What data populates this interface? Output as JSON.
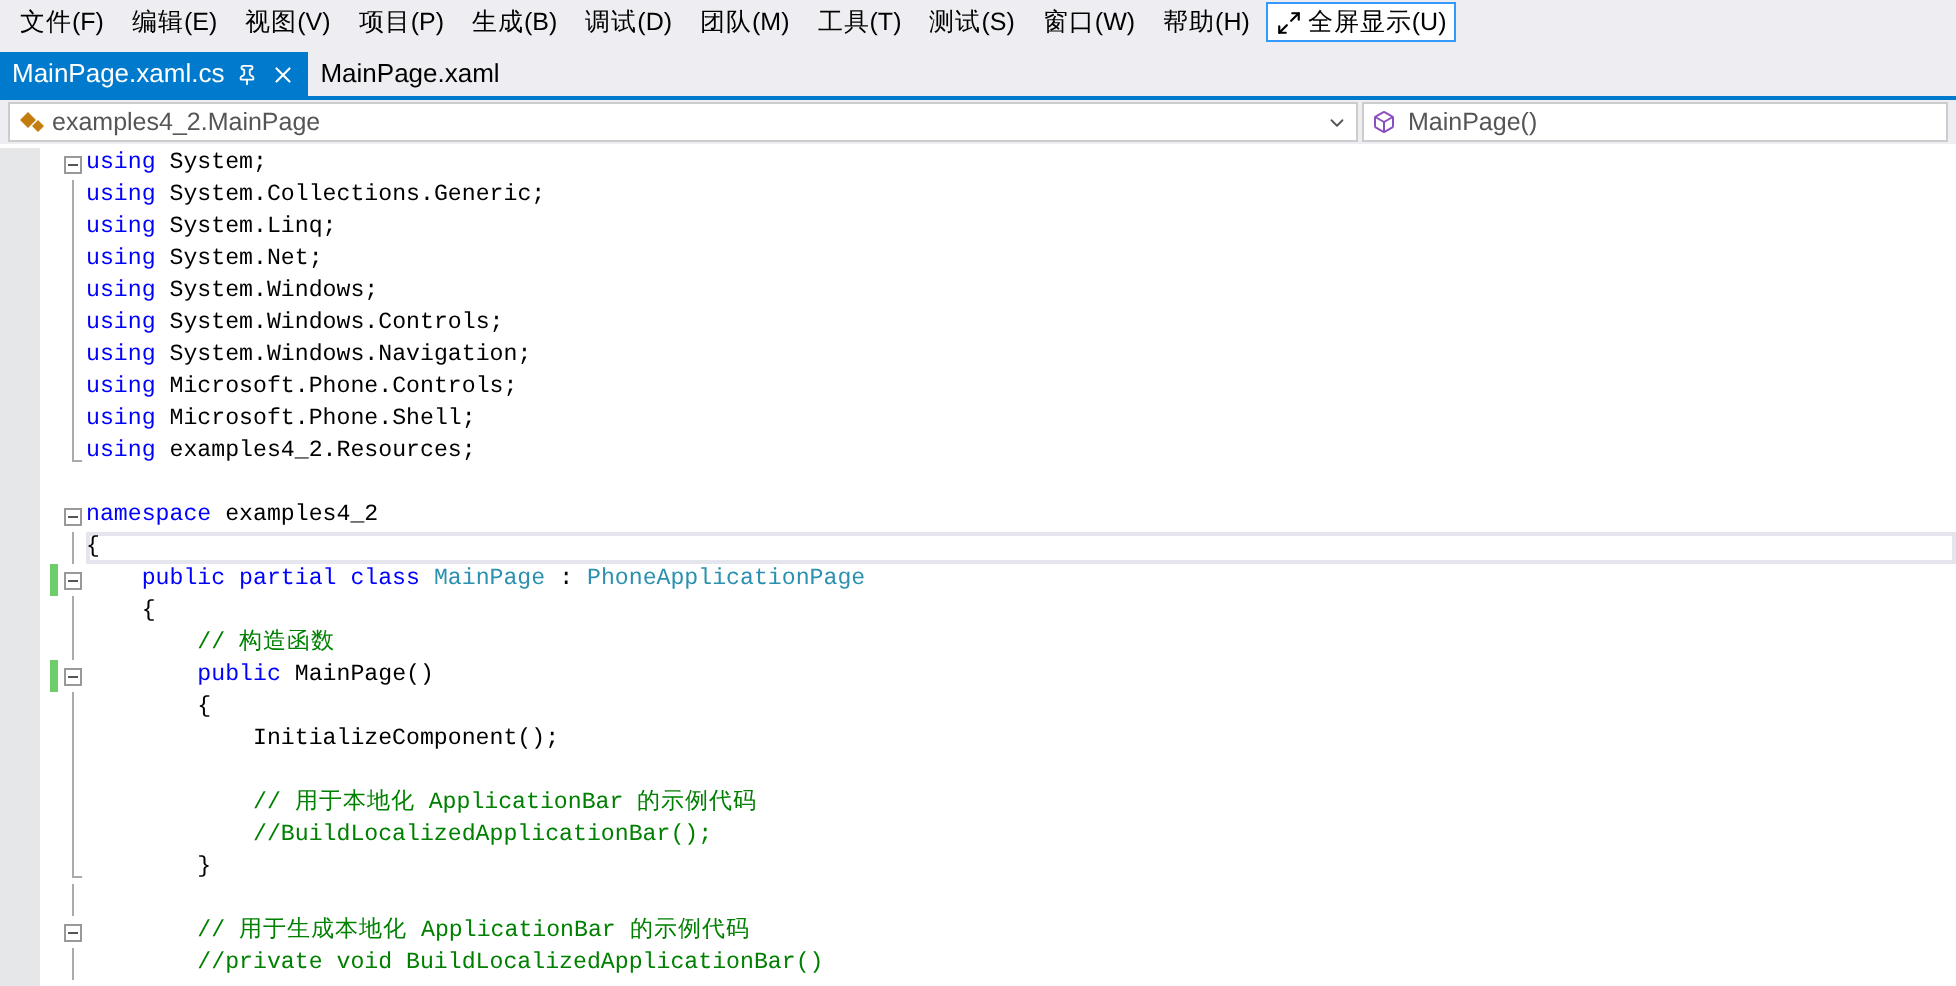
{
  "menu": [
    {
      "label": "文件(F)"
    },
    {
      "label": "编辑(E)"
    },
    {
      "label": "视图(V)"
    },
    {
      "label": "项目(P)"
    },
    {
      "label": "生成(B)"
    },
    {
      "label": "调试(D)"
    },
    {
      "label": "团队(M)"
    },
    {
      "label": "工具(T)"
    },
    {
      "label": "测试(S)"
    },
    {
      "label": "窗口(W)"
    },
    {
      "label": "帮助(H)"
    }
  ],
  "fullscreen_button": {
    "label": "全屏显示(U)"
  },
  "tabs": [
    {
      "label": "MainPage.xaml.cs",
      "selected": true
    },
    {
      "label": "MainPage.xaml",
      "selected": false
    }
  ],
  "nav": {
    "type_dropdown": "examples4_2.MainPage",
    "member_dropdown": "MainPage()"
  },
  "code": [
    {
      "kind": "start",
      "changed": false,
      "current": false,
      "tokens": [
        {
          "kind": "keyword",
          "t": "using"
        },
        {
          "kind": "plain",
          "t": " System;"
        }
      ]
    },
    {
      "kind": "body",
      "changed": false,
      "current": false,
      "tokens": [
        {
          "kind": "keyword",
          "t": "using"
        },
        {
          "kind": "plain",
          "t": " System.Collections.Generic;"
        }
      ]
    },
    {
      "kind": "body",
      "changed": false,
      "current": false,
      "tokens": [
        {
          "kind": "keyword",
          "t": "using"
        },
        {
          "kind": "plain",
          "t": " System.Linq;"
        }
      ]
    },
    {
      "kind": "body",
      "changed": false,
      "current": false,
      "tokens": [
        {
          "kind": "keyword",
          "t": "using"
        },
        {
          "kind": "plain",
          "t": " System.Net;"
        }
      ]
    },
    {
      "kind": "body",
      "changed": false,
      "current": false,
      "tokens": [
        {
          "kind": "keyword",
          "t": "using"
        },
        {
          "kind": "plain",
          "t": " System.Windows;"
        }
      ]
    },
    {
      "kind": "body",
      "changed": false,
      "current": false,
      "tokens": [
        {
          "kind": "keyword",
          "t": "using"
        },
        {
          "kind": "plain",
          "t": " System.Windows.Controls;"
        }
      ]
    },
    {
      "kind": "body",
      "changed": false,
      "current": false,
      "tokens": [
        {
          "kind": "keyword",
          "t": "using"
        },
        {
          "kind": "plain",
          "t": " System.Windows.Navigation;"
        }
      ]
    },
    {
      "kind": "body",
      "changed": false,
      "current": false,
      "tokens": [
        {
          "kind": "keyword",
          "t": "using"
        },
        {
          "kind": "plain",
          "t": " Microsoft.Phone.Controls;"
        }
      ]
    },
    {
      "kind": "body",
      "changed": false,
      "current": false,
      "tokens": [
        {
          "kind": "keyword",
          "t": "using"
        },
        {
          "kind": "plain",
          "t": " Microsoft.Phone.Shell;"
        }
      ]
    },
    {
      "kind": "end",
      "changed": false,
      "current": false,
      "tokens": [
        {
          "kind": "keyword",
          "t": "using"
        },
        {
          "kind": "plain",
          "t": " examples4_2.Resources;"
        }
      ]
    },
    {
      "kind": "blank",
      "changed": false,
      "current": false
    },
    {
      "kind": "start",
      "changed": false,
      "current": false,
      "tokens": [
        {
          "kind": "keyword",
          "t": "namespace"
        },
        {
          "kind": "plain",
          "t": " examples4_2"
        }
      ]
    },
    {
      "kind": "body",
      "changed": false,
      "current": true,
      "tokens": [
        {
          "kind": "plain",
          "t": "{"
        }
      ]
    },
    {
      "kind": "start",
      "changed": true,
      "current": false,
      "tokens": [
        {
          "kind": "keyword",
          "t": "    public partial class"
        },
        {
          "kind": "type",
          "t": " MainPage"
        },
        {
          "kind": "plain",
          "t": " : "
        },
        {
          "kind": "type",
          "t": "PhoneApplicationPage"
        }
      ]
    },
    {
      "kind": "body",
      "changed": false,
      "current": false,
      "tokens": [
        {
          "kind": "plain",
          "t": "    {"
        }
      ]
    },
    {
      "kind": "body",
      "changed": false,
      "current": false,
      "tokens": [
        {
          "kind": "comment",
          "t": "        // 构造函数"
        }
      ]
    },
    {
      "kind": "start",
      "changed": true,
      "current": false,
      "tokens": [
        {
          "kind": "keyword",
          "t": "        public"
        },
        {
          "kind": "plain",
          "t": " MainPage()"
        }
      ]
    },
    {
      "kind": "body",
      "changed": false,
      "current": false,
      "tokens": [
        {
          "kind": "plain",
          "t": "        {"
        }
      ]
    },
    {
      "kind": "body",
      "changed": false,
      "current": false,
      "tokens": [
        {
          "kind": "plain",
          "t": "            InitializeComponent();"
        }
      ]
    },
    {
      "kind": "body",
      "changed": false,
      "current": false
    },
    {
      "kind": "body",
      "changed": false,
      "current": false,
      "tokens": [
        {
          "kind": "comment",
          "t": "            // 用于本地化 ApplicationBar 的示例代码"
        }
      ]
    },
    {
      "kind": "body",
      "changed": false,
      "current": false,
      "tokens": [
        {
          "kind": "comment",
          "t": "            //BuildLocalizedApplicationBar();"
        }
      ]
    },
    {
      "kind": "end",
      "changed": false,
      "current": false,
      "tokens": [
        {
          "kind": "plain",
          "t": "        }"
        }
      ]
    },
    {
      "kind": "body",
      "changed": false,
      "current": false
    },
    {
      "kind": "start",
      "changed": false,
      "current": false,
      "tokens": [
        {
          "kind": "comment",
          "t": "        // 用于生成本地化 ApplicationBar 的示例代码"
        }
      ]
    },
    {
      "kind": "body",
      "changed": false,
      "current": false,
      "tokens": [
        {
          "kind": "comment",
          "t": "        //private void BuildLocalizedApplicationBar()"
        }
      ]
    }
  ]
}
